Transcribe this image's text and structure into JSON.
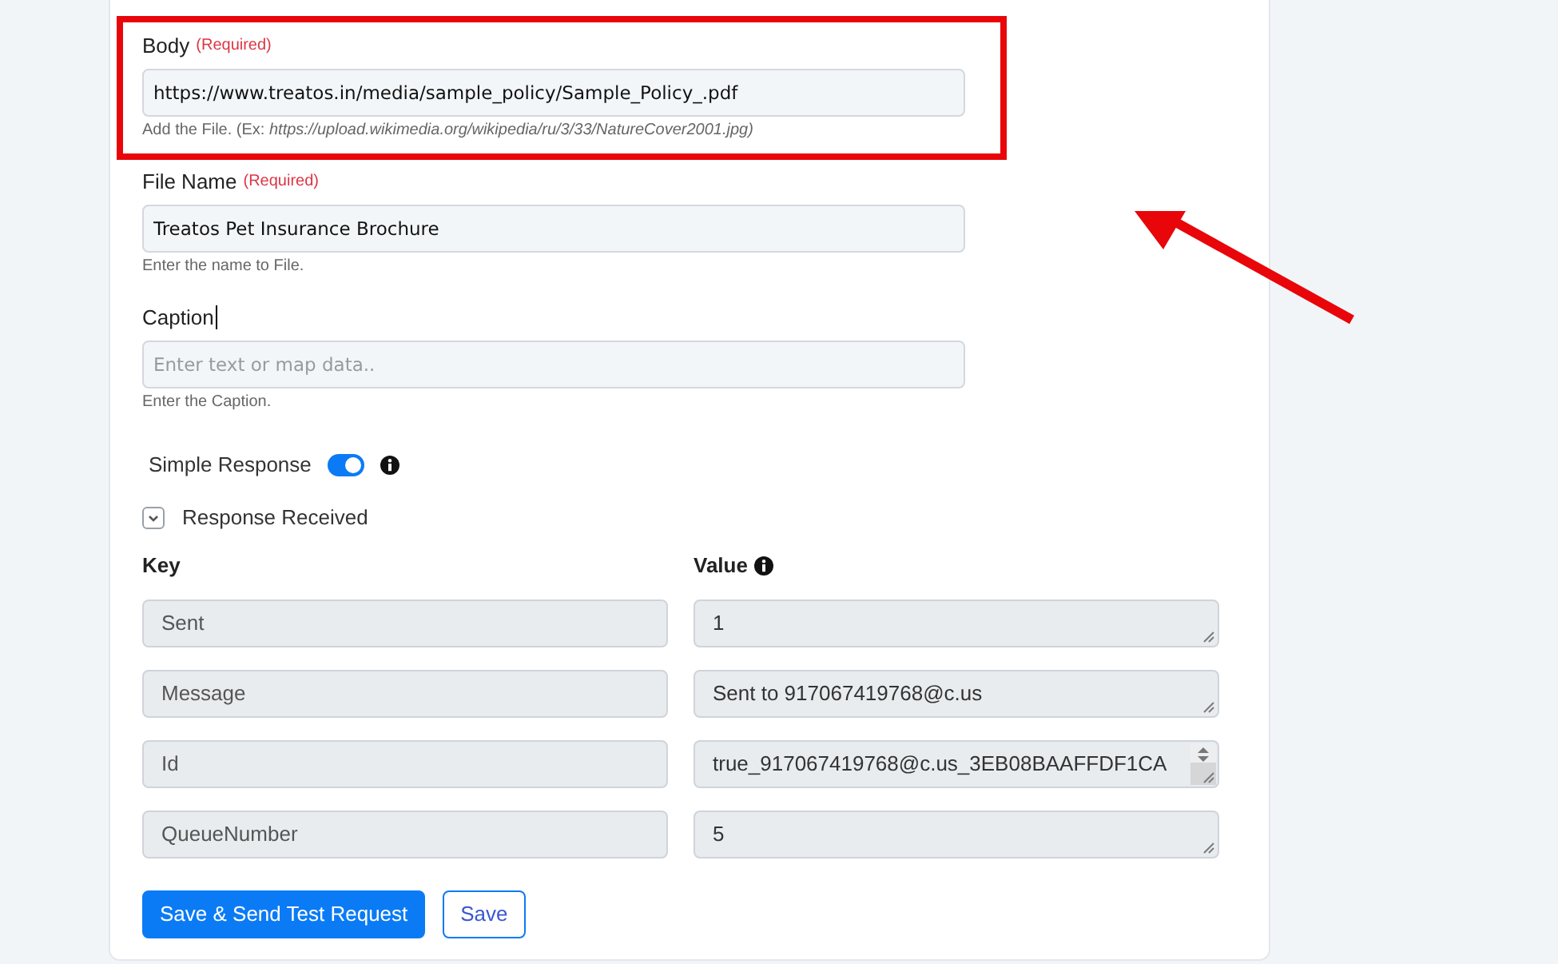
{
  "form_fields": [
    {
      "label": "Body",
      "required_note": "(Required)",
      "value": "https://www.treatos.in/media/sample_policy/Sample_Policy_.pdf",
      "help": "Add the File. (Ex: *https://upload.wikimedia.org/wikipedia/ru/3/33/NatureCover2001.jpg)*",
      "highlighted": true,
      "text_cursor": false
    },
    {
      "label": "File Name",
      "required_note": "(Required)",
      "value": "Treatos Pet Insurance Brochure",
      "help": "Enter the name to File.",
      "highlighted": false,
      "text_cursor": false
    },
    {
      "label": "Caption",
      "placeholder": "Enter text or map data..",
      "help": "Enter the Caption.",
      "highlighted": false,
      "text_cursor": true
    }
  ],
  "simple_response": {
    "label": "Simple Response",
    "on": true,
    "info": true
  },
  "response_received": {
    "label": "Response Received",
    "expanded": true
  },
  "response_table": {
    "columns": [
      {
        "label": "Key",
        "info": false
      },
      {
        "label": "Value",
        "info": true
      }
    ],
    "rows": [
      {
        "key": "Sent",
        "value": "1",
        "scrollbar": false
      },
      {
        "key": "Message",
        "value": "Sent to 917067419768@c.us",
        "scrollbar": false
      },
      {
        "key": "Id",
        "value": "true_917067419768@c.us_3EB08BAAFFDF1CA",
        "scrollbar": true
      },
      {
        "key": "QueueNumber",
        "value": "5",
        "scrollbar": false
      }
    ]
  },
  "buttons": [
    {
      "label": "Save & Send Test Request",
      "kind": "primary"
    },
    {
      "label": "Save",
      "kind": "outline"
    }
  ]
}
